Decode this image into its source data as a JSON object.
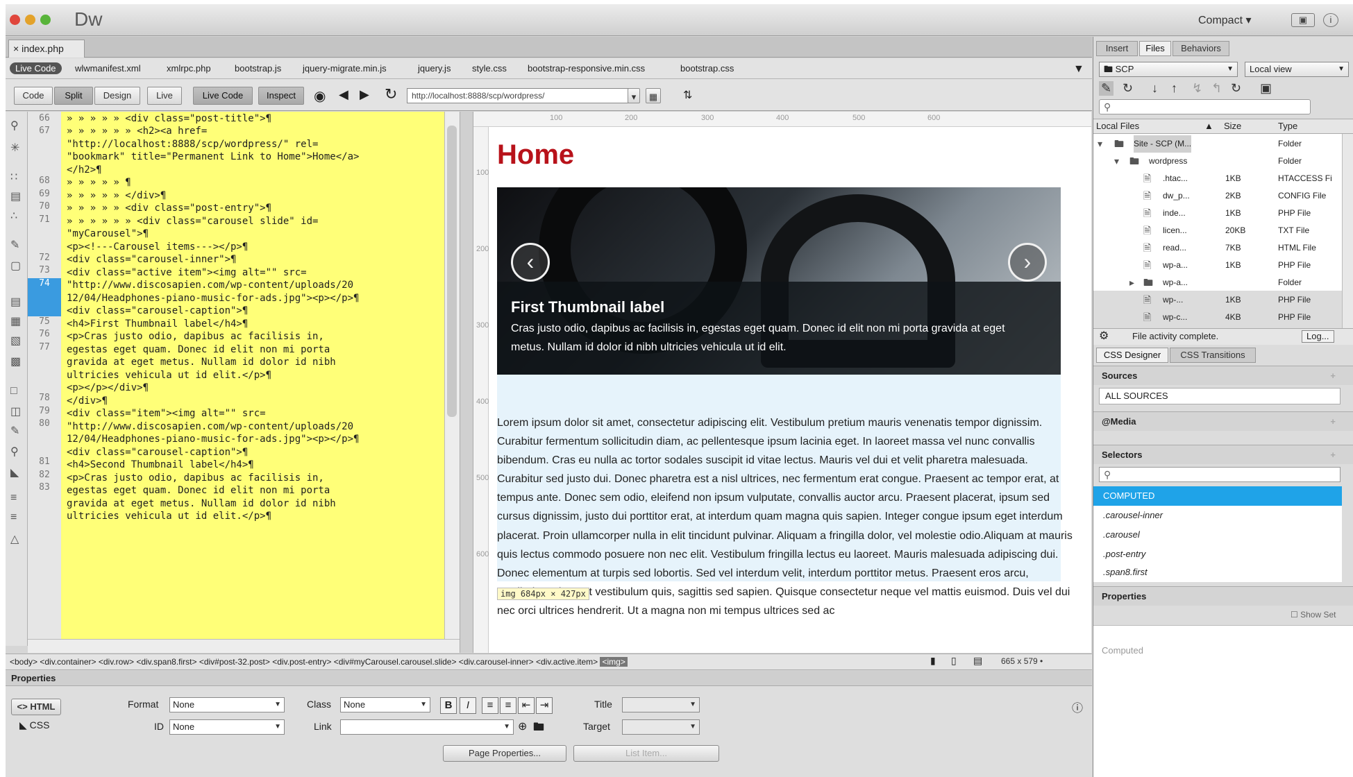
{
  "app": {
    "name": "Dw",
    "layout": "Compact"
  },
  "doc_tab": "index.php",
  "related_files": [
    "Live Code",
    "wlwmanifest.xml",
    "xmlrpc.php",
    "bootstrap.js",
    "jquery-migrate.min.js",
    "jquery.js",
    "style.css",
    "bootstrap-responsive.min.css",
    "bootstrap.css"
  ],
  "view_buttons": {
    "code": "Code",
    "split": "Split",
    "design": "Design",
    "live": "Live",
    "live_code": "Live Code",
    "inspect": "Inspect"
  },
  "url": "http://localhost:8888/scp/wordpress/",
  "line_numbers": [
    "66",
    "67",
    "",
    "",
    "68",
    "69",
    "70",
    "71",
    "",
    "72",
    "73",
    "74",
    "",
    "",
    "75",
    "76",
    "77",
    "",
    "",
    "",
    "78",
    "79",
    "80",
    "",
    "",
    "81",
    "82",
    "83",
    "",
    ""
  ],
  "code_lines": [
    "» » » » » <div class=\"post-title\">¶",
    "» » » » » » <h2><a href=",
    "\"http://localhost:8888/scp/wordpress/\" rel=",
    "\"bookmark\" title=\"Permanent Link to Home\">Home</a>",
    "</h2>¶",
    "» » » » » ¶",
    "» » » » » </div>¶",
    "» » » » » <div class=\"post-entry\">¶",
    "» » » » » » <div class=\"carousel slide\" id=",
    "\"myCarousel\">¶",
    "<p><!---Carousel items---></p>¶",
    "<div class=\"carousel-inner\">¶",
    "<div class=\"active item\"><img alt=\"\" src=",
    "\"http://www.discosapien.com/wp-content/uploads/20",
    "12/04/Headphones-piano-music-for-ads.jpg\"><p></p>¶",
    "<div class=\"carousel-caption\">¶",
    "<h4>First Thumbnail label</h4>¶",
    "<p>Cras justo odio, dapibus ac facilisis in,",
    "egestas eget quam. Donec id elit non mi porta",
    "gravida at eget metus. Nullam id dolor id nibh",
    "ultricies vehicula ut id elit.</p>¶",
    "<p></p></div>¶",
    "</div>¶",
    "<div class=\"item\"><img alt=\"\" src=",
    "\"http://www.discosapien.com/wp-content/uploads/20",
    "12/04/Headphones-piano-music-for-ads.jpg\"><p></p>¶",
    "<div class=\"carousel-caption\">¶",
    "<h4>Second Thumbnail label</h4>¶",
    "<p>Cras justo odio, dapibus ac facilisis in,",
    "egestas eget quam. Donec id elit non mi porta",
    "gravida at eget metus. Nullam id dolor id nibh",
    "ultricies vehicula ut id elit.</p>¶"
  ],
  "ruler_top": [
    "100",
    "200",
    "300",
    "400",
    "500",
    "600"
  ],
  "ruler_left": [
    "100",
    "200",
    "300",
    "400",
    "500",
    "600"
  ],
  "design": {
    "heading": "Home",
    "caption_title": "First Thumbnail label",
    "caption_body": "Cras justo odio, dapibus ac facilisis in, egestas eget quam. Donec id elit non mi porta gravida at eget metus. Nullam id dolor id nibh ultricies vehicula ut id elit.",
    "paragraph": "Lorem ipsum dolor sit amet, consectetur adipiscing elit. Vestibulum pretium mauris venenatis tempor dignissim. Curabitur fermentum sollicitudin diam, ac pellentesque ipsum lacinia eget. In laoreet massa vel nunc convallis bibendum. Cras eu nulla ac tortor sodales suscipit id vitae lectus. Mauris vel dui et velit pharetra malesuada. Curabitur sed justo dui. Donec pharetra est a nisl ultrices, nec fermentum erat congue. Praesent ac tempor erat, at tempus ante. Donec sem odio, eleifend non ipsum vulputate, convallis auctor arcu. Praesent placerat, ipsum sed cursus dignissim, justo dui porttitor erat, at interdum quam magna quis sapien. Integer congue ipsum eget interdum placerat. Proin ullamcorper nulla in elit tincidunt pulvinar. Aliquam a fringilla dolor, vel molestie odio.Aliquam at mauris quis lectus commodo posuere non nec elit. Vestibulum fringilla lectus eu laoreet. Mauris malesuada adipiscing dui. Donec elementum at turpis sed lobortis. Sed vel interdum velit, interdum porttitor metus. Praesent eros arcu, vestibulum sit amet vestibulum quis, sagittis sed sapien. Quisque consectetur neque vel mattis euismod. Duis vel dui nec orci ultrices hendrerit. Ut a magna non mi tempus ultrices sed ac",
    "img_tooltip": "img 684px × 427px"
  },
  "tag_selector": "<body> <div.container> <div.row> <div.span8.first> <div#post-32.post> <div.post-entry> <div#myCarousel.carousel.slide> <div.carousel-inner> <div.active.item>",
  "tag_selected": "<img>",
  "window_size": "665 x 579 •",
  "properties": {
    "title": "Properties",
    "html": "HTML",
    "css": "CSS",
    "format_label": "Format",
    "format_value": "None",
    "id_label": "ID",
    "id_value": "None",
    "class_label": "Class",
    "class_value": "None",
    "link_label": "Link",
    "title_label": "Title",
    "target_label": "Target",
    "page_properties": "Page Properties...",
    "list_item": "List Item..."
  },
  "right": {
    "tabs": [
      "Insert",
      "Files",
      "Behaviors"
    ],
    "site": "SCP",
    "view": "Local view",
    "col_local": "Local Files",
    "col_size": "Size",
    "col_type": "Type",
    "files": [
      {
        "name": "Site - SCP (M...",
        "size": "",
        "type": "Folder",
        "indent": 0
      },
      {
        "name": "wordpress",
        "size": "",
        "type": "Folder",
        "indent": 1
      },
      {
        "name": ".htac...",
        "size": "1KB",
        "type": "HTACCESS Fi",
        "indent": 2
      },
      {
        "name": "dw_p...",
        "size": "2KB",
        "type": "CONFIG File",
        "indent": 2
      },
      {
        "name": "inde...",
        "size": "1KB",
        "type": "PHP File",
        "indent": 2
      },
      {
        "name": "licen...",
        "size": "20KB",
        "type": "TXT File",
        "indent": 2
      },
      {
        "name": "read...",
        "size": "7KB",
        "type": "HTML File",
        "indent": 2
      },
      {
        "name": "wp-a...",
        "size": "1KB",
        "type": "PHP File",
        "indent": 2
      },
      {
        "name": "wp-a...",
        "size": "",
        "type": "Folder",
        "indent": 2
      },
      {
        "name": "wp-...",
        "size": "1KB",
        "type": "PHP File",
        "indent": 2
      },
      {
        "name": "wp-c...",
        "size": "4KB",
        "type": "PHP File",
        "indent": 2
      }
    ],
    "status": "File activity complete.",
    "log": "Log...",
    "css_tabs": [
      "CSS Designer",
      "CSS Transitions"
    ],
    "sources": "Sources",
    "all_sources": "ALL SOURCES",
    "media": "@Media",
    "selectors": "Selectors",
    "selector_items": [
      "COMPUTED",
      ".carousel-inner",
      ".carousel",
      ".post-entry",
      ".span8.first"
    ],
    "properties": "Properties",
    "show_set": "Show Set",
    "computed": "Computed"
  },
  "colors": {
    "code_bg": "#ffff78",
    "heading": "#b8121a",
    "selection": "#3a9be0"
  }
}
